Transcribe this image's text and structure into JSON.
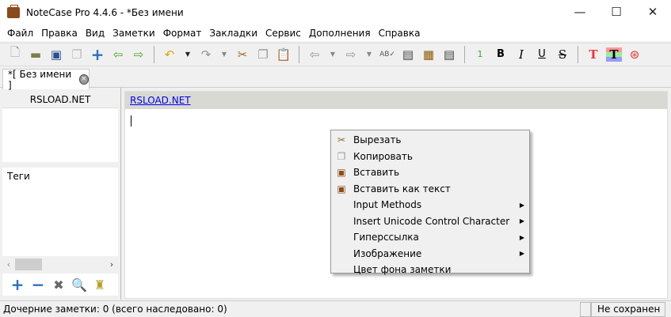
{
  "window": {
    "title": "NoteCase Pro 4.4.6 - *Без имени",
    "minimize": "—",
    "maximize": "☐",
    "close": "✕"
  },
  "menu": [
    "Файл",
    "Правка",
    "Вид",
    "Заметки",
    "Формат",
    "Закладки",
    "Сервис",
    "Дополнения",
    "Справка"
  ],
  "toolbar": {
    "heading_level": "1",
    "bold": "B",
    "italic": "I",
    "underline": "U",
    "strike": "S"
  },
  "tab": {
    "label": "*[ Без имени ]"
  },
  "tree": {
    "header": "RSLOAD.NET",
    "tags_label": "Теги"
  },
  "editor": {
    "note_title": "RSLOAD.NET"
  },
  "context_menu": [
    {
      "label": "Вырезать",
      "icon": "scissors-icon"
    },
    {
      "label": "Копировать",
      "icon": "copy-icon"
    },
    {
      "label": "Вставить",
      "icon": "paste-icon"
    },
    {
      "label": "Вставить как текст",
      "icon": "paste-text-icon"
    },
    {
      "label": "Input Methods",
      "submenu": true
    },
    {
      "label": "Insert Unicode Control Character",
      "submenu": true
    },
    {
      "label": "Гиперссылка",
      "submenu": true
    },
    {
      "label": "Изображение",
      "submenu": true
    },
    {
      "label": "Цвет фона заметки"
    }
  ],
  "status": {
    "children": "Дочерние заметки: 0 (всего наследовано: 0)",
    "saved": "Не сохранен"
  }
}
